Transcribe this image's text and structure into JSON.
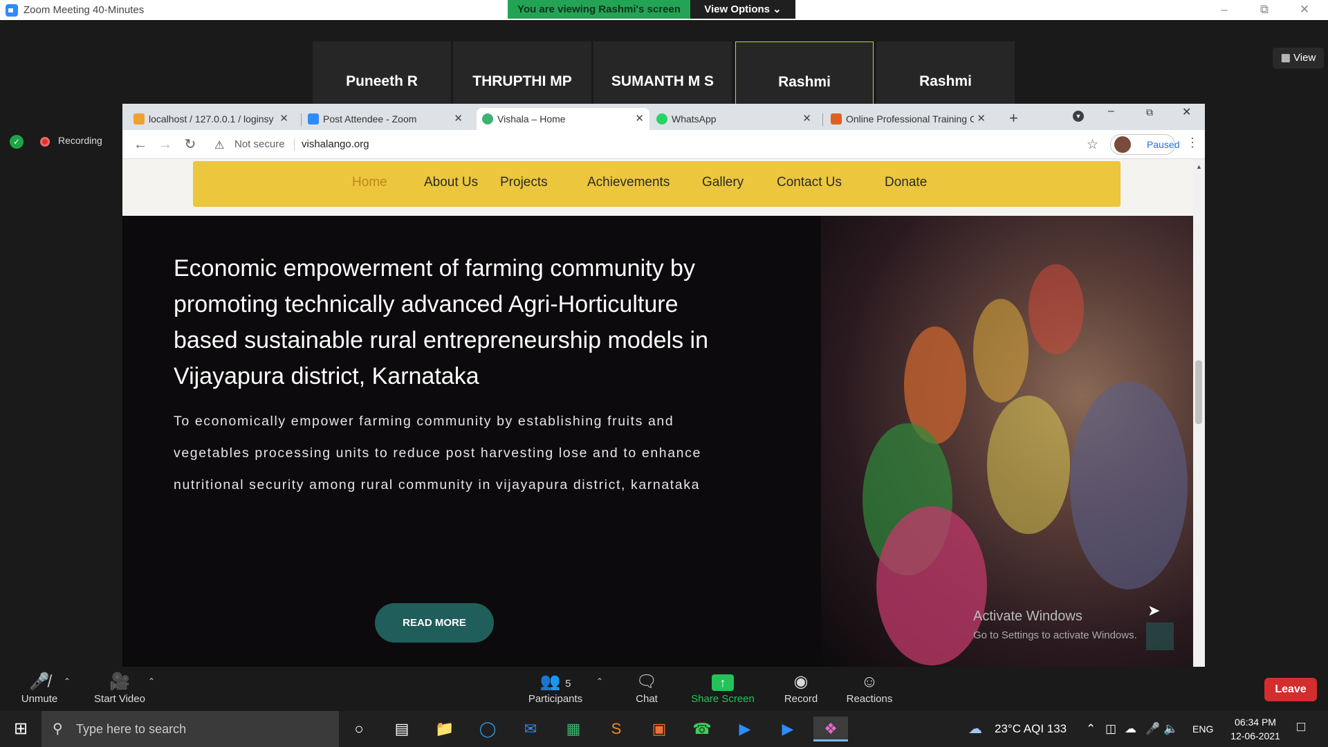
{
  "zoom": {
    "window_title": "Zoom Meeting 40-Minutes",
    "banner": "You are viewing Rashmi's screen",
    "view_options": "View Options ⌄",
    "view_button": "▦ View",
    "recording_label": "Recording",
    "participants": [
      {
        "name": "Puneeth R",
        "muted": true
      },
      {
        "name": "THRUPTHI MP",
        "muted": true
      },
      {
        "name": "SUMANTH M S",
        "muted": false
      },
      {
        "name": "Rashmi",
        "muted": false,
        "active": true
      },
      {
        "name": "Rashmi",
        "muted": true
      }
    ],
    "toolbar": {
      "unmute": "Unmute",
      "start_video": "Start Video",
      "participants": "Participants",
      "participants_count": "5",
      "chat": "Chat",
      "share_screen": "Share Screen",
      "record": "Record",
      "reactions": "Reactions",
      "leave": "Leave"
    }
  },
  "browser": {
    "tabs": [
      {
        "title": "localhost / 127.0.0.1 / loginsy",
        "icon": "phpmyadmin-icon",
        "color": "#f0a030"
      },
      {
        "title": "Post Attendee - Zoom",
        "icon": "zoom-icon",
        "color": "#2d8cff"
      },
      {
        "title": "Vishala – Home",
        "icon": "vishala-icon",
        "color": "#3cb371",
        "active": true
      },
      {
        "title": "WhatsApp",
        "icon": "whatsapp-icon",
        "color": "#25d366"
      },
      {
        "title": "Online Professional Training C",
        "icon": "training-icon",
        "color": "#e06020"
      }
    ],
    "not_secure": "Not secure",
    "url": "vishalango.org",
    "profile_status": "Paused"
  },
  "site": {
    "nav": [
      "Home",
      "About Us",
      "Projects",
      "Achievements",
      "Gallery",
      "Contact Us",
      "Donate"
    ],
    "nav_active": "Home",
    "headline": "Economic empowerment of farming community by promoting technically advanced Agri-Horticulture based sustainable rural entrepreneurship models in Vijayapura district, Karnataka",
    "subtext": "To economically empower farming community by establishing fruits and vegetables processing units to reduce post harvesting lose and to enhance nutritional security among rural community in vijayapura district, karnataka",
    "cta": "READ MORE",
    "accent": "#ecc63c",
    "button_color": "#1f5e5a"
  },
  "watermark": {
    "title": "Activate Windows",
    "subtitle": "Go to Settings to activate Windows."
  },
  "taskbar": {
    "search_placeholder": "Type here to search",
    "weather": "23°C  AQI 133",
    "language": "ENG",
    "time": "06:34 PM",
    "date": "12-06-2021"
  }
}
